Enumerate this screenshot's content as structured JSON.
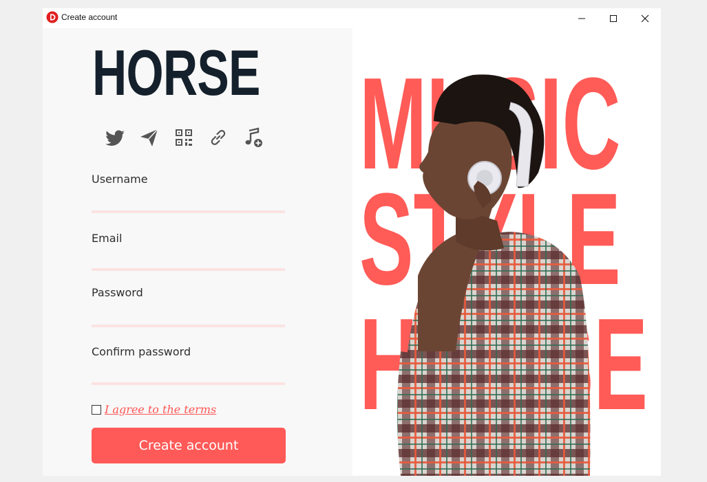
{
  "window": {
    "title": "Create account",
    "app_icon": "app-logo-d-icon",
    "controls": [
      "minimize-icon",
      "maximize-icon",
      "close-icon"
    ]
  },
  "brand": {
    "name": "HORSE",
    "color": "#14202b"
  },
  "social_icons": [
    "twitter-icon",
    "send-icon",
    "qr-code-icon",
    "link-icon",
    "music-add-icon"
  ],
  "form": {
    "username_label": "Username",
    "username_value": "",
    "email_label": "Email",
    "email_value": "",
    "password_label": "Password",
    "password_value": "",
    "confirm_label": "Confirm password",
    "confirm_value": "",
    "terms_checked": false,
    "terms_text": "I agree to the terms",
    "submit_label": "Create account"
  },
  "poster": {
    "lines": [
      "MUSIC",
      "STYLE",
      "HORSE"
    ],
    "text_color": "#ff5b57"
  },
  "colors": {
    "accent": "#ff5a57",
    "underline": "#fbe3e2",
    "panel_bg": "#f8f8f8"
  }
}
